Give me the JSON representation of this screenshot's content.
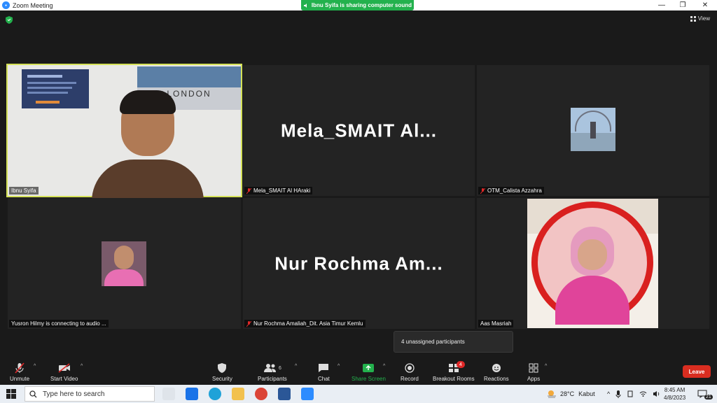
{
  "window": {
    "title": "Zoom Meeting",
    "minimize": "—",
    "restore": "❐",
    "close": "✕"
  },
  "share_banner": "Ibnu Syifa is sharing computer sound",
  "view_label": "View",
  "participants": [
    {
      "name": "Ibnu Syifa",
      "display": "",
      "muted": false
    },
    {
      "name": "Mela_SMAIT Al HAraki",
      "display": "Mela_SMAIT  Al...",
      "muted": true
    },
    {
      "name": "OTM_Calista Azzahra",
      "display": "",
      "muted": true
    },
    {
      "name": "Yusron Hilmy is connecting to audio ...",
      "display": "",
      "muted": false
    },
    {
      "name": "Nur Rochma Amaliah_Dit. Asia Timur Kemlu",
      "display": "Nur  Rochma  Am...",
      "muted": true
    },
    {
      "name": "Aas Masriah",
      "display": "",
      "muted": false
    }
  ],
  "video_overlay_text": "LONDON",
  "toolbar": {
    "unmute": "Unmute",
    "start_video": "Start Video",
    "security": "Security",
    "participants": "Participants",
    "participants_count": "6",
    "chat": "Chat",
    "share_screen": "Share Screen",
    "record": "Record",
    "breakout_rooms": "Breakout Rooms",
    "breakout_badge": "4",
    "reactions": "Reactions",
    "apps": "Apps",
    "leave": "Leave"
  },
  "tooltip": "4 unassigned participants",
  "taskbar": {
    "search_placeholder": "Type here to search",
    "weather_temp": "28°C",
    "weather_label": "Kabut",
    "time": "8:45 AM",
    "date": "4/8/2023",
    "notification_count": "21"
  },
  "colors": {
    "active_speaker": "#d4e157",
    "share_green": "#23b14d",
    "leave_red": "#d92d20",
    "mute_red": "#e02828"
  }
}
